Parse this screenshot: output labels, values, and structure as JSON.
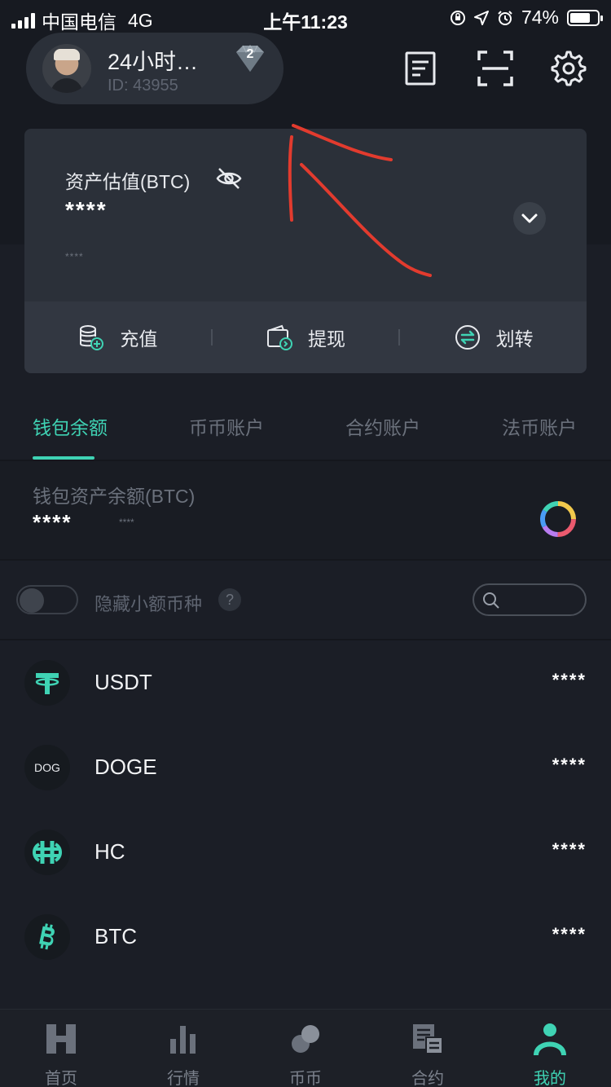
{
  "status_bar": {
    "carrier": "中国电信",
    "network": "4G",
    "time": "上午11:23",
    "battery": "74%",
    "battery_level": 0.74
  },
  "profile": {
    "name": "24小时…",
    "id_text": "ID: 43955",
    "badge_level": "2"
  },
  "header_icons": [
    "document-icon",
    "scan-icon",
    "gear-icon"
  ],
  "asset_card": {
    "title": "资产估值(BTC)",
    "value": "****",
    "sub_value": "****",
    "actions": [
      {
        "label": "充值",
        "icon": "deposit-icon"
      },
      {
        "label": "提现",
        "icon": "withdraw-icon"
      },
      {
        "label": "划转",
        "icon": "transfer-icon"
      }
    ]
  },
  "tabs": [
    {
      "label": "钱包余额",
      "active": true
    },
    {
      "label": "币币账户",
      "active": false
    },
    {
      "label": "合约账户",
      "active": false
    },
    {
      "label": "法币账户",
      "active": false
    }
  ],
  "wallet": {
    "label": "钱包资产余额(BTC)",
    "value": "****",
    "sub_value": "****"
  },
  "filter": {
    "hide_small_label": "隐藏小额币种",
    "help": "?",
    "search_placeholder": ""
  },
  "coins": [
    {
      "name": "USDT",
      "value": "****",
      "icon_text": "",
      "color": "#3fd3b4"
    },
    {
      "name": "DOGE",
      "value": "****",
      "icon_text": "DOG",
      "color": "#e8eaee"
    },
    {
      "name": "HC",
      "value": "****",
      "icon_text": "",
      "color": "#3fd3b4"
    },
    {
      "name": "BTC",
      "value": "****",
      "icon_text": "",
      "color": "#3fd3b4"
    }
  ],
  "bottom_nav": [
    {
      "label": "首页",
      "icon": "home-icon",
      "active": false
    },
    {
      "label": "行情",
      "icon": "chart-icon",
      "active": false
    },
    {
      "label": "币币",
      "icon": "coins-icon",
      "active": false
    },
    {
      "label": "合约",
      "icon": "contract-icon",
      "active": false
    },
    {
      "label": "我的",
      "icon": "profile-icon",
      "active": true
    }
  ],
  "colors": {
    "accent": "#3fd3b4",
    "background": "#1b1e26",
    "card": "#2b3039",
    "annotation_red": "#e23b2e"
  }
}
